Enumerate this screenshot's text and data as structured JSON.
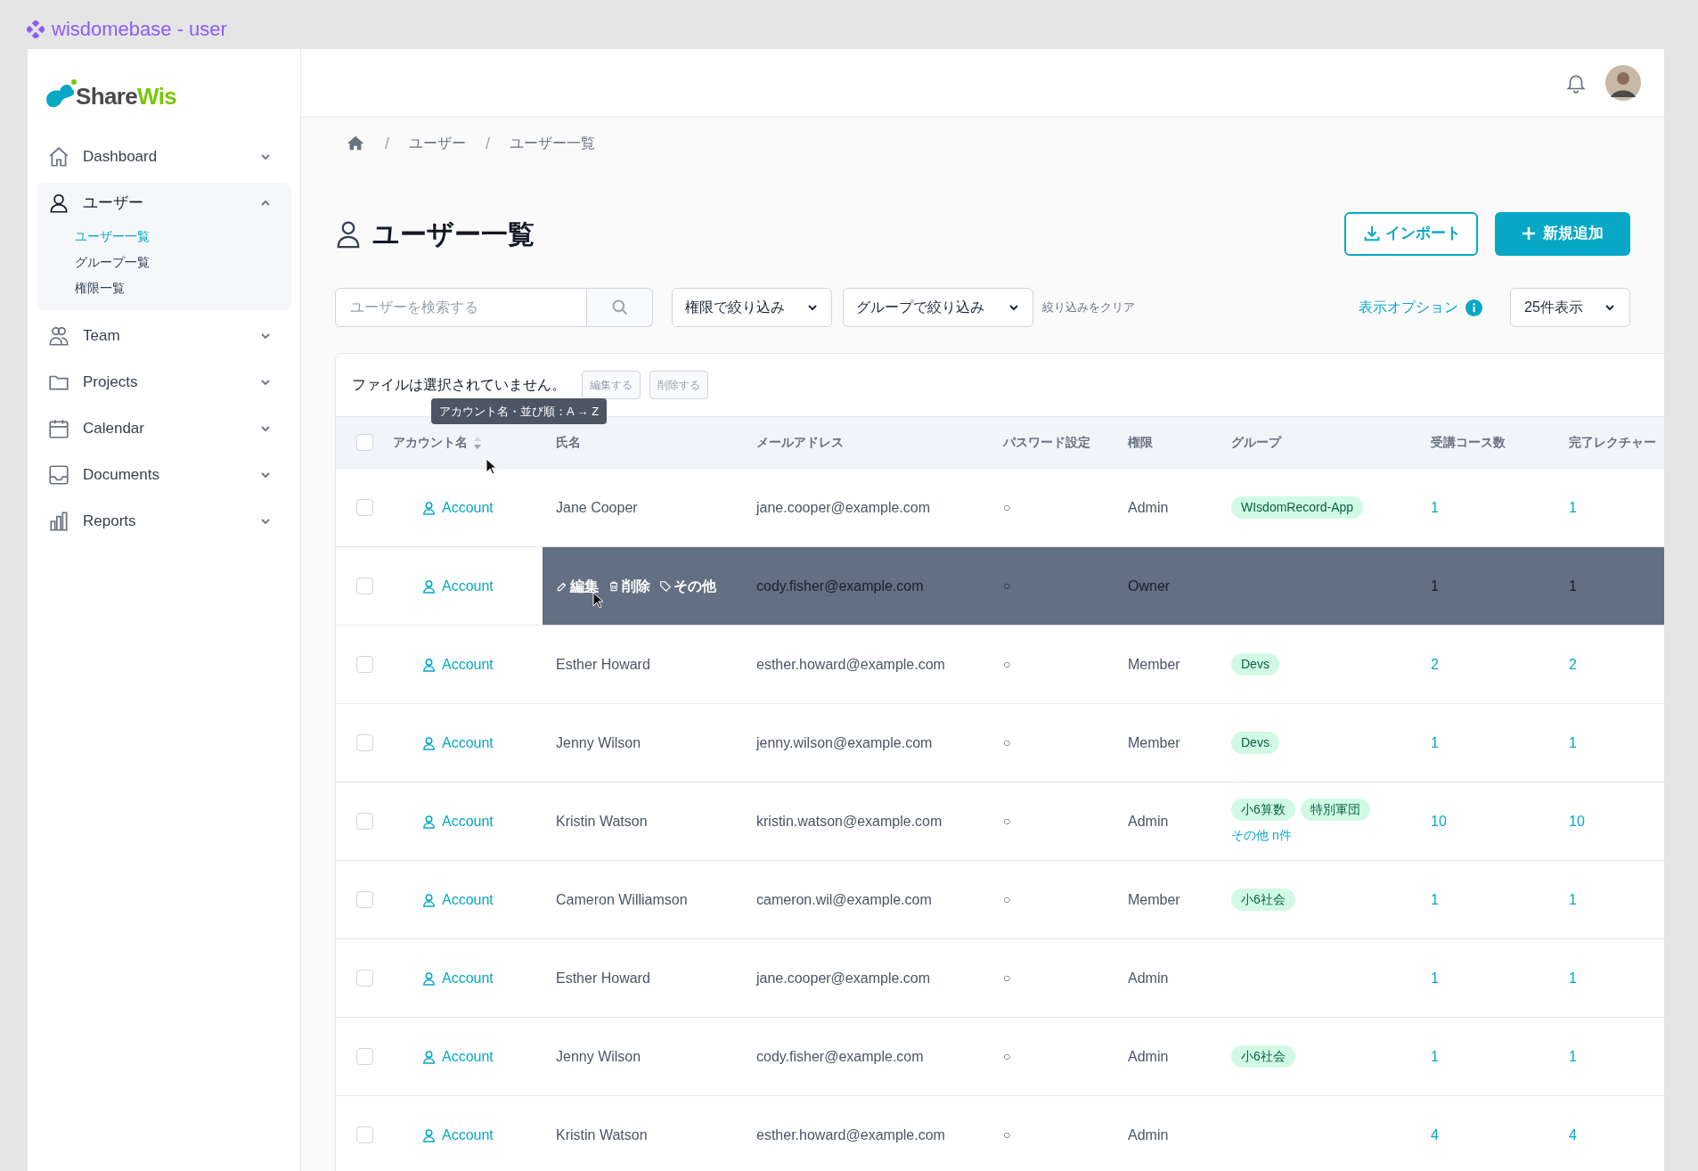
{
  "app_title": "wisdomebase - user",
  "logo": {
    "part_1": "Share",
    "part_2": "Wis"
  },
  "sidebar": {
    "items": [
      {
        "label": "Dashboard",
        "expanded": false
      },
      {
        "label": "ユーザー",
        "expanded": true,
        "children": [
          {
            "label": "ユーザー一覧",
            "selected": true
          },
          {
            "label": "グループ一覧",
            "selected": false
          },
          {
            "label": "権限一覧",
            "selected": false
          }
        ]
      },
      {
        "label": "Team",
        "expanded": false
      },
      {
        "label": "Projects",
        "expanded": false
      },
      {
        "label": "Calendar",
        "expanded": false
      },
      {
        "label": "Documents",
        "expanded": false
      },
      {
        "label": "Reports",
        "expanded": false
      }
    ]
  },
  "breadcrumb": {
    "separator": "/",
    "items": [
      "ユーザー",
      "ユーザー一覧"
    ]
  },
  "page_title": "ユーザー一覧",
  "buttons": {
    "import": "インポート",
    "add": "新規追加"
  },
  "search": {
    "placeholder": "ユーザーを検索する"
  },
  "filters": [
    "権限で絞り込み",
    "グループで絞り込み"
  ],
  "clear_filters": "絞り込みをクリア",
  "display_options": "表示オプション",
  "per_page": "25件表示",
  "bulk": {
    "message": "ファイルは選択されていません。",
    "actions": [
      {
        "label": "編集する",
        "disabled": true
      },
      {
        "label": "削除する",
        "disabled": true
      }
    ]
  },
  "tooltip": "アカウント名・並び順：A → Z",
  "select_all_checked": false,
  "columns": [
    "アカウント名",
    "氏名",
    "メールアドレス",
    "パスワード設定",
    "権限",
    "グループ",
    "受講コース数",
    "完了レクチャー"
  ],
  "rows": [
    {
      "checked": false,
      "hovered": false,
      "account": "Account",
      "name": "Jane Cooper",
      "email": "jane.cooper@example.com",
      "password": "○",
      "role": "Admin",
      "groups": [
        "WIsdomRecord-App"
      ],
      "courses": "1",
      "lectures": "1"
    },
    {
      "checked": false,
      "hovered": true,
      "account": "Account",
      "actions": [
        "編集",
        "削除",
        "その他"
      ],
      "email": "cody.fisher@example.com",
      "password": "○",
      "role": "Owner",
      "courses": "1",
      "lectures": "1"
    },
    {
      "checked": false,
      "hovered": false,
      "account": "Account",
      "name": "Esther Howard",
      "email": "esther.howard@example.com",
      "password": "○",
      "role": "Member",
      "groups": [
        "Devs"
      ],
      "courses": "2",
      "lectures": "2"
    },
    {
      "checked": false,
      "hovered": false,
      "account": "Account",
      "name": "Jenny Wilson",
      "email": "jenny.wilson@example.com",
      "password": "○",
      "role": "Member",
      "groups": [
        "Devs"
      ],
      "courses": "1",
      "lectures": "1"
    },
    {
      "checked": false,
      "hovered": false,
      "account": "Account",
      "name": "Kristin Watson",
      "email": "kristin.watson@example.com",
      "password": "○",
      "role": "Admin",
      "groups": [
        "小6算数",
        "特別軍団"
      ],
      "more": "その他 n件",
      "courses": "10",
      "lectures": "10"
    },
    {
      "checked": false,
      "hovered": false,
      "account": "Account",
      "name": "Cameron Williamson",
      "email": "cameron.wil@example.com",
      "password": "○",
      "role": "Member",
      "groups": [
        "小6社会"
      ],
      "courses": "1",
      "lectures": "1"
    },
    {
      "checked": false,
      "hovered": false,
      "account": "Account",
      "name": "Esther Howard",
      "email": "jane.cooper@example.com",
      "password": "○",
      "role": "Admin",
      "courses": "1",
      "lectures": "1"
    },
    {
      "checked": false,
      "hovered": false,
      "account": "Account",
      "name": "Jenny Wilson",
      "email": "cody.fisher@example.com",
      "password": "○",
      "role": "Admin",
      "groups": [
        "小6社会"
      ],
      "courses": "1",
      "lectures": "1"
    },
    {
      "checked": false,
      "hovered": false,
      "account": "Account",
      "name": "Kristin Watson",
      "email": "esther.howard@example.com",
      "password": "○",
      "role": "Admin",
      "courses": "4",
      "lectures": "4"
    }
  ]
}
